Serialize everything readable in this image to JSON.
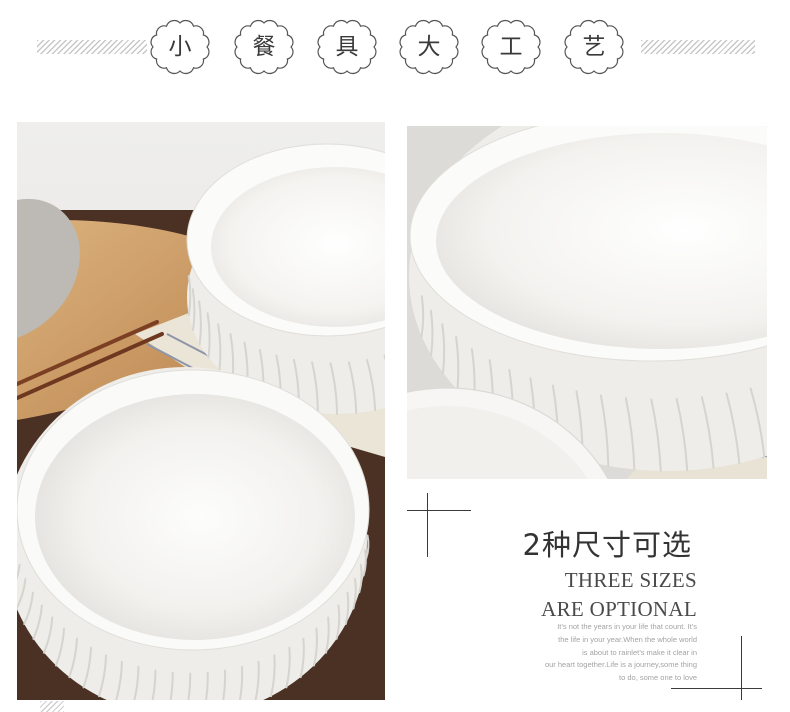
{
  "header": {
    "characters": [
      "小",
      "餐",
      "具",
      "大",
      "工",
      "艺"
    ]
  },
  "feature": {
    "title_cn": "2种尺寸可选",
    "title_en_line1": "THREE SIZES",
    "title_en_line2": "ARE OPTIONAL",
    "paragraph_lines": [
      "It’s not the years in your life that count. It’s",
      "the life in your year.When the whole world",
      "is about to rainlet’s make it clear in",
      "our heart together.Life is a journey,some thing",
      "to do, some one to love"
    ]
  },
  "colors": {
    "text": "#333333",
    "subtitle": "#4a4a4a",
    "muted": "#a3a3a3",
    "badge_border": "#555555",
    "hatch": "#c8c8c8"
  }
}
